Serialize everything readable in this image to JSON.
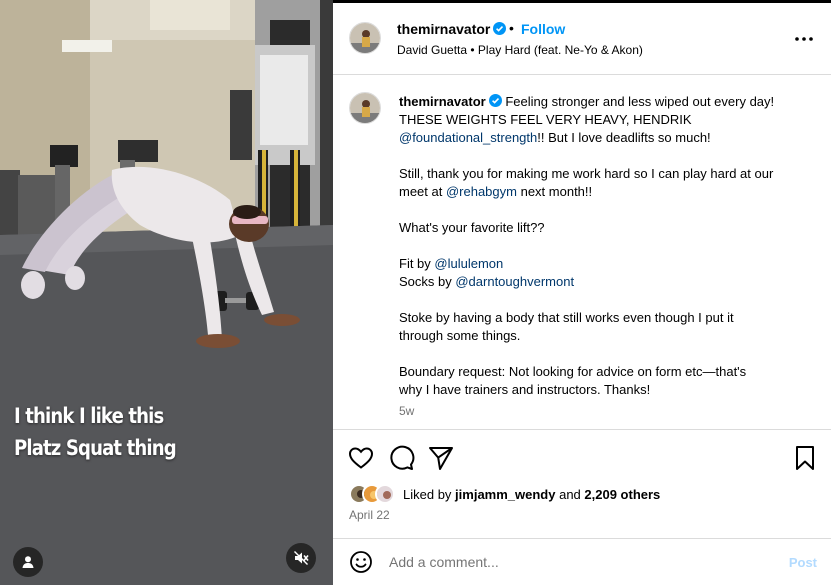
{
  "media": {
    "overlay_lines": [
      "I think I like this",
      "Platz Squat thing"
    ],
    "tag_icon": "person-tag-icon",
    "mute_icon": "speaker-muted-icon"
  },
  "header": {
    "username": "themirnavator",
    "follow": "Follow",
    "dot": "•",
    "audio": "David Guetta • Play Hard (feat. Ne-Yo & Akon)",
    "more_icon": "more-horizontal-icon"
  },
  "caption": {
    "username": "themirnavator",
    "l1": "Feeling stronger and less wiped out every day!",
    "l2": "THESE WEIGHTS FEEL VERY HEAVY, HENDRIK",
    "l3_mention": "@foundational_strength",
    "l3_rest": "!! But I love deadlifts so much!",
    "l4": "Still, thank you for making me work hard so I can play hard at our",
    "l5_pre": "meet at ",
    "l5_mention": "@rehabgym",
    "l5_rest": " next month!!",
    "l6": "What's your favorite lift??",
    "l7_pre": "Fit by ",
    "l7_mention": "@lululemon",
    "l8_pre": "Socks by ",
    "l8_mention": "@darntoughvermont",
    "l9": "Stoke by having a body that still works even though I put it",
    "l10": "through some things.",
    "l11": "Boundary request: Not looking for advice on form etc—that's",
    "l12": "why I have trainers and instructors. Thanks!",
    "timestamp": "5w"
  },
  "actions": {
    "like_icon": "heart-icon",
    "comment_icon": "comment-bubble-icon",
    "share_icon": "paper-plane-icon",
    "save_icon": "bookmark-icon"
  },
  "likes": {
    "prefix": "Liked by ",
    "user": "jimjamm_wendy",
    "middle": " and ",
    "count": "2,209 others"
  },
  "date": "April 22",
  "comment": {
    "placeholder": "Add a comment...",
    "post": "Post",
    "emoji_icon": "smiley-icon"
  },
  "colors": {
    "accent": "#0095f6",
    "mention": "#00376b",
    "muted": "#737373",
    "post_disabled": "#b3dbff"
  }
}
